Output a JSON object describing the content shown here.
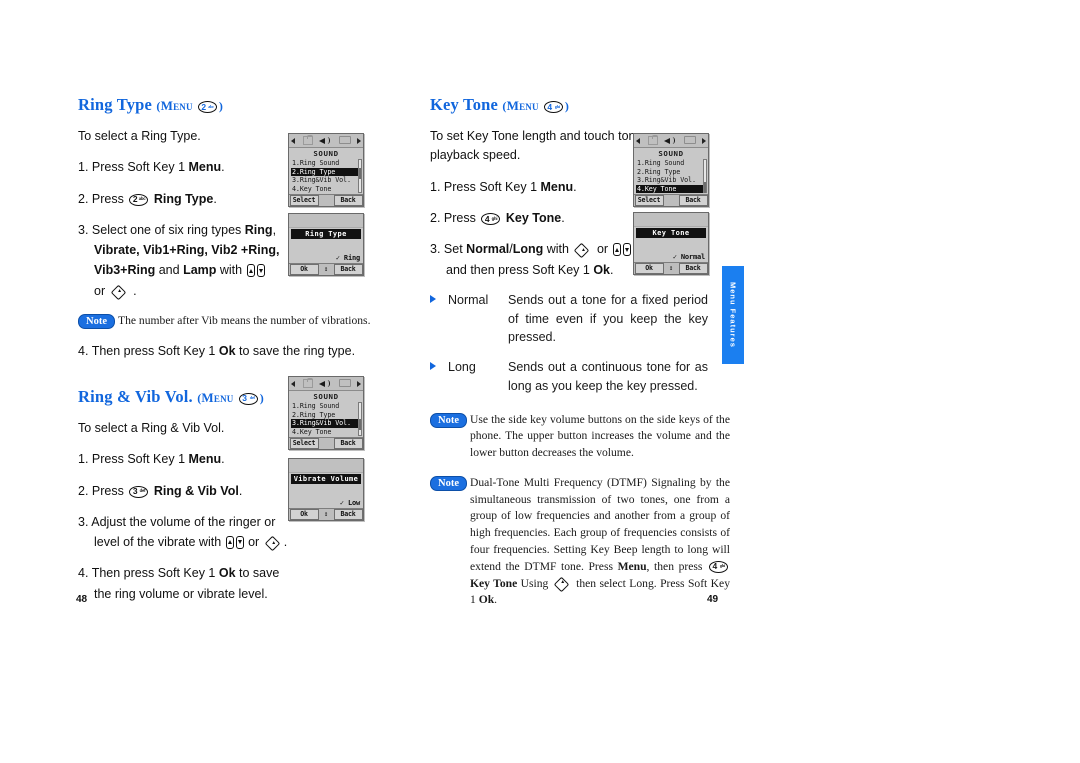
{
  "colors": {
    "heading_blue": "#1166dd",
    "note_badge_blue": "#1b6fe0",
    "side_tab_blue": "#1b7ff0"
  },
  "side_tab": {
    "label": "Menu Features"
  },
  "page_numbers": {
    "left": "48",
    "right": "49"
  },
  "left_column": {
    "section_ring_type": {
      "heading": "Ring Type",
      "heading_menu_open": "(",
      "heading_menu_word": "Menu",
      "heading_menu_close": ")",
      "key": {
        "num": "2",
        "sub": "abc"
      },
      "intro": "To select a Ring Type.",
      "steps": [
        {
          "n": "1.",
          "text_before": "Press Soft Key 1 ",
          "bold": "Menu",
          "text_after": "."
        },
        {
          "n": "2.",
          "text_before": "Press ",
          "key": {
            "num": "2",
            "sub": "abc"
          },
          "bold": "Ring Type",
          "text_after": "."
        },
        {
          "n": "3.",
          "line1_before": "Select one of six ring types ",
          "line1_bold": "Ring",
          "line1_after": ",",
          "line2": "Vibrate, Vib1+Ring, Vib2 +Ring,",
          "line3_bold_a": "Vib3+Ring",
          "line3_mid": " and ",
          "line3_bold_b": "Lamp",
          "line3_after": " with ",
          "line4": "or"
        },
        {
          "n": "4.",
          "text_before": "Then press Soft Key 1 ",
          "bold": "Ok",
          "text_after": " to save the ring type."
        }
      ],
      "note": "The number after Vib means the number of vibrations.",
      "note_label": "Note"
    },
    "section_ring_vib_vol": {
      "heading": "Ring  & Vib Vol.",
      "heading_menu_word": "Menu",
      "key": {
        "num": "3",
        "sub": "def"
      },
      "intro": "To select a Ring & Vib Vol.",
      "steps": [
        {
          "n": "1.",
          "text_before": "Press Soft Key 1",
          "bold": "Menu",
          "text_after": "."
        },
        {
          "n": "2.",
          "text_before": "Press ",
          "key": {
            "num": "3",
            "sub": "def"
          },
          "bold": "Ring & Vib Vol",
          "text_after": "."
        },
        {
          "n": "3.",
          "line1": "Adjust the volume of the ringer or",
          "line2_before": "level of the vibrate with ",
          "line2_mid": " or ",
          "line2_after": "."
        },
        {
          "n": "4.",
          "line1_before": "Then press Soft Key 1 ",
          "line1_bold": "Ok",
          "line1_after": " to save",
          "line2": "the ring volume or vibrate level."
        }
      ]
    },
    "phones": {
      "sound_menu_ring_type": {
        "title": "SOUND",
        "rows": [
          "1.Ring Sound",
          "2.Ring Type",
          "3.Ring&Vib Vol.",
          "4.Key Tone"
        ],
        "selected_index": 1,
        "softkey_left": "Select",
        "softkey_right": "Back"
      },
      "ring_type_dialog": {
        "bar_title": "Ring Type",
        "value": "✓ Ring",
        "softkey_left": "Ok",
        "softkey_mid": "↕",
        "softkey_right": "Back"
      },
      "sound_menu_ring_vib": {
        "title": "SOUND",
        "rows": [
          "1.Ring Sound",
          "2.Ring Type",
          "3.Ring&Vib Vol.",
          "4.Key Tone"
        ],
        "selected_index": 2,
        "softkey_left": "Select",
        "softkey_right": "Back"
      },
      "vibrate_volume_dialog": {
        "bar_title": "Vibrate Volume",
        "value": "✓ Low",
        "softkey_left": "Ok",
        "softkey_mid": "↕",
        "softkey_right": "Back"
      }
    }
  },
  "right_column": {
    "section_key_tone": {
      "heading": "Key Tone",
      "heading_menu_word": "Menu",
      "key": {
        "num": "4",
        "sub": "ghi"
      },
      "intro_line1": "To set Key Tone length and touch tone",
      "intro_line2": "playback speed.",
      "steps": [
        {
          "n": "1.",
          "text_before": "Press  Soft Key 1",
          "bold": "Menu",
          "text_after": "."
        },
        {
          "n": "2.",
          "text_before": "Press ",
          "key": {
            "num": "4",
            "sub": "ghi"
          },
          "bold": "Key Tone",
          "text_after": "."
        },
        {
          "n": "3.",
          "line1_before": "Set ",
          "line1_bold_a": "Normal",
          "line1_slash": "/",
          "line1_bold_b": "Long",
          "line1_with": " with ",
          "line1_or": " or ",
          "line2_before": "and then press Soft Key 1 ",
          "line2_bold": "Ok",
          "line2_after": "."
        }
      ],
      "definitions": [
        {
          "term": "Normal",
          "desc": "Sends out a tone for a fixed period of time even if you keep the key pressed."
        },
        {
          "term": "Long",
          "desc": "Sends out a continuous tone for as long as you keep the key pressed."
        }
      ],
      "note_label": "Note",
      "note1": "Use the side key volume buttons on the side keys of the phone. The upper button increases the volume and the lower button decreases the volume.",
      "note2_part1": "Dual-Tone Multi Frequency (DTMF) Signaling by the simultaneous transmission of two tones, one from a group of low frequencies and  another from a group of high frequencies. Each group of frequencies consists of four frequencies. Setting Key Beep length to long will extend the DTMF tone. Press ",
      "note2_menu": "Menu",
      "note2_part2": ", then press ",
      "note2_keytone": "Key Tone",
      "note2_part3": " Using ",
      "note2_part4": " then select Long. Press Soft Key 1 ",
      "note2_ok": "Ok",
      "note2_end": "."
    },
    "phones": {
      "sound_menu_key_tone": {
        "title": "SOUND",
        "rows": [
          "1.Ring Sound",
          "2.Ring Type",
          "3.Ring&Vib Vol.",
          "4.Key Tone"
        ],
        "selected_index": 3,
        "softkey_left": "Select",
        "softkey_right": "Back"
      },
      "key_tone_dialog": {
        "bar_title": "Key Tone",
        "value": "✓ Normal",
        "softkey_left": "Ok",
        "softkey_mid": "↕",
        "softkey_right": "Back"
      }
    }
  }
}
